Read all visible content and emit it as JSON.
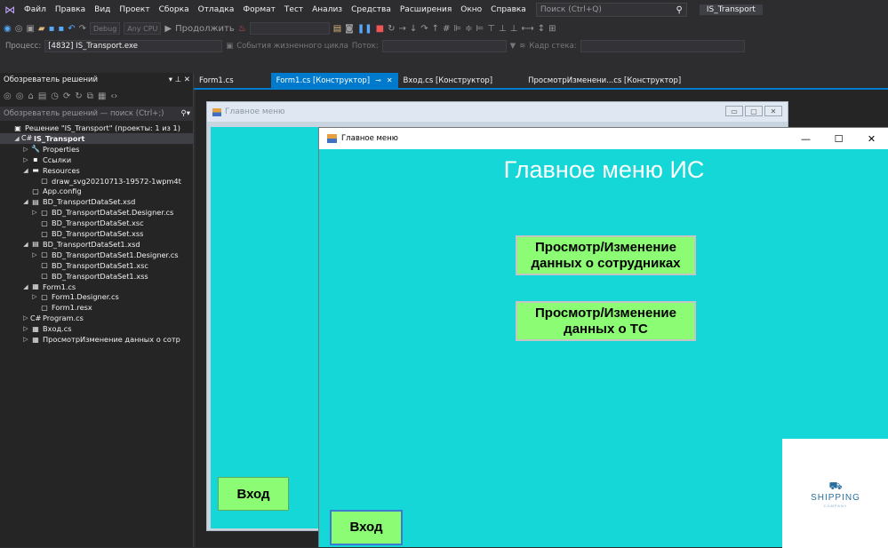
{
  "menu": {
    "items": [
      "Файл",
      "Правка",
      "Вид",
      "Проект",
      "Сборка",
      "Отладка",
      "Формат",
      "Тест",
      "Анализ",
      "Средства",
      "Расширения",
      "Окно",
      "Справка"
    ],
    "search_placeholder": "Поиск (Ctrl+Q)",
    "project_name": "IS_Transport"
  },
  "toolbar": {
    "config": "Debug",
    "platform": "Any CPU",
    "continue_label": "Продолжить",
    "process_label": "Процесс:",
    "process_value": "[4832] IS_Transport.exe",
    "lifecycle_label": "События жизненного цикла",
    "thread_label": "Поток:",
    "stack_label": "Кадр стека:"
  },
  "solution_explorer": {
    "title": "Обозреватель решений",
    "search_placeholder": "Обозреватель решений — поиск (Ctrl+;)",
    "tree": [
      {
        "label": "Решение \"IS_Transport\" (проекты: 1 из 1)",
        "indent": 0,
        "arrow": "",
        "icon": "▣"
      },
      {
        "label": "IS_Transport",
        "indent": 1,
        "arrow": "◢",
        "icon": "C#",
        "selected": true
      },
      {
        "label": "Properties",
        "indent": 2,
        "arrow": "▷",
        "icon": "🔧"
      },
      {
        "label": "Ссылки",
        "indent": 2,
        "arrow": "▷",
        "icon": "▪"
      },
      {
        "label": "Resources",
        "indent": 2,
        "arrow": "◢",
        "icon": "▬"
      },
      {
        "label": "draw_svg20210713-19572-1wpm4t",
        "indent": 3,
        "arrow": "",
        "icon": "▢"
      },
      {
        "label": "App.config",
        "indent": 2,
        "arrow": "",
        "icon": "▢"
      },
      {
        "label": "BD_TransportDataSet.xsd",
        "indent": 2,
        "arrow": "◢",
        "icon": "▤"
      },
      {
        "label": "BD_TransportDataSet.Designer.cs",
        "indent": 3,
        "arrow": "▷",
        "icon": "▢"
      },
      {
        "label": "BD_TransportDataSet.xsc",
        "indent": 3,
        "arrow": "",
        "icon": "▢"
      },
      {
        "label": "BD_TransportDataSet.xss",
        "indent": 3,
        "arrow": "",
        "icon": "▢"
      },
      {
        "label": "BD_TransportDataSet1.xsd",
        "indent": 2,
        "arrow": "◢",
        "icon": "▤"
      },
      {
        "label": "BD_TransportDataSet1.Designer.cs",
        "indent": 3,
        "arrow": "▷",
        "icon": "▢"
      },
      {
        "label": "BD_TransportDataSet1.xsc",
        "indent": 3,
        "arrow": "",
        "icon": "▢"
      },
      {
        "label": "BD_TransportDataSet1.xss",
        "indent": 3,
        "arrow": "",
        "icon": "▢"
      },
      {
        "label": "Form1.cs",
        "indent": 2,
        "arrow": "◢",
        "icon": "▦"
      },
      {
        "label": "Form1.Designer.cs",
        "indent": 3,
        "arrow": "▷",
        "icon": "▢"
      },
      {
        "label": "Form1.resx",
        "indent": 3,
        "arrow": "",
        "icon": "▢"
      },
      {
        "label": "Program.cs",
        "indent": 2,
        "arrow": "▷",
        "icon": "C#"
      },
      {
        "label": "Вход.cs",
        "indent": 2,
        "arrow": "▷",
        "icon": "▦"
      },
      {
        "label": "ПросмотрИзменение данных о сотр",
        "indent": 2,
        "arrow": "▷",
        "icon": "▦"
      }
    ]
  },
  "tabs": [
    {
      "label": "Form1.cs",
      "active": false
    },
    {
      "label": "Form1.cs [Конструктор]",
      "active": true
    },
    {
      "label": "Вход.cs [Конструктор]",
      "active": false
    },
    {
      "label": "ПросмотрИзменени...cs [Конструктор]",
      "active": false
    }
  ],
  "designer_form": {
    "title": "Главное меню",
    "login_button": "Вход"
  },
  "running_form": {
    "title": "Главное меню",
    "heading": "Главное меню ИС",
    "button_staff": "Просмотр/Изменение данных о сотрудниках",
    "button_ts": "Просмотр/Изменение данных о ТС",
    "button_login": "Вход",
    "logo_text": "SHIPPING",
    "logo_sub": "COMPANY"
  },
  "colors": {
    "accent": "#007acc",
    "form_back": "#16d7d7",
    "button_green": "#8cfc74"
  }
}
